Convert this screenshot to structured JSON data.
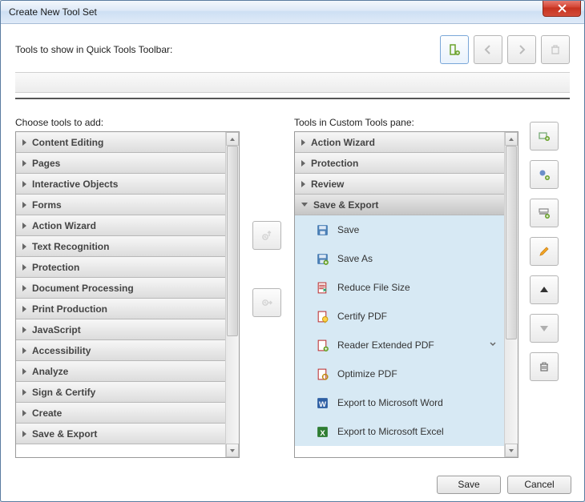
{
  "window": {
    "title": "Create New Tool Set"
  },
  "quick": {
    "label": "Tools to show in Quick Tools Toolbar:"
  },
  "topbtns": {
    "add_icon": "add-panel-icon",
    "prev_icon": "left-arrow-icon",
    "next_icon": "right-arrow-icon",
    "trash_icon": "trash-icon"
  },
  "left": {
    "label": "Choose tools to add:",
    "items": [
      "Content Editing",
      "Pages",
      "Interactive Objects",
      "Forms",
      "Action Wizard",
      "Text Recognition",
      "Protection",
      "Document Processing",
      "Print Production",
      "JavaScript",
      "Accessibility",
      "Analyze",
      "Sign & Certify",
      "Create",
      "Save & Export"
    ]
  },
  "mid": {
    "moveUp": "move-up-icon",
    "moveRight": "move-right-icon"
  },
  "right": {
    "label": "Tools in Custom Tools pane:",
    "groups": [
      "Action Wizard",
      "Protection",
      "Review",
      "Save & Export"
    ],
    "openGroup": "Save & Export",
    "sub": [
      {
        "label": "Save",
        "icon": "save"
      },
      {
        "label": "Save As",
        "icon": "saveas"
      },
      {
        "label": "Reduce File Size",
        "icon": "reduce"
      },
      {
        "label": "Certify PDF",
        "icon": "certify"
      },
      {
        "label": "Reader Extended PDF",
        "icon": "reader",
        "submenu": true
      },
      {
        "label": "Optimize PDF",
        "icon": "optimize"
      },
      {
        "label": "Export to Microsoft Word",
        "icon": "word"
      },
      {
        "label": "Export to Microsoft Excel",
        "icon": "excel"
      }
    ]
  },
  "side": {
    "items": [
      {
        "name": "add-tool",
        "icon": "addtool"
      },
      {
        "name": "add-category",
        "icon": "addcat"
      },
      {
        "name": "add-separator",
        "icon": "addsep"
      },
      {
        "name": "edit",
        "icon": "pencil"
      },
      {
        "name": "move-up",
        "icon": "up",
        "fill": true
      },
      {
        "name": "move-down",
        "icon": "down",
        "disabled": true
      },
      {
        "name": "delete",
        "icon": "trash"
      }
    ]
  },
  "footer": {
    "save": "Save",
    "cancel": "Cancel"
  }
}
